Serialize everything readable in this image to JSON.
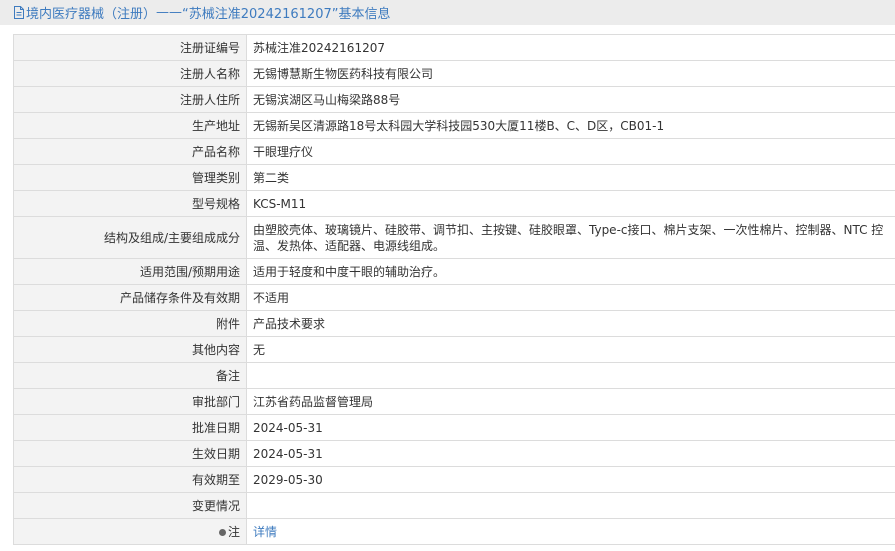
{
  "header": {
    "prefix": "境内医疗器械（注册）",
    "separator": " —— ",
    "title": "“苏械注准20242161207”基本信息"
  },
  "rows": [
    {
      "label": "注册证编号",
      "value": "苏械注准20242161207"
    },
    {
      "label": "注册人名称",
      "value": "无锡博慧斯生物医药科技有限公司"
    },
    {
      "label": "注册人住所",
      "value": "无锡滨湖区马山梅梁路88号"
    },
    {
      "label": "生产地址",
      "value": "无锡新吴区清源路18号太科园大学科技园530大厦11楼B、C、D区，CB01-1"
    },
    {
      "label": "产品名称",
      "value": "干眼理疗仪"
    },
    {
      "label": "管理类别",
      "value": "第二类"
    },
    {
      "label": "型号规格",
      "value": "KCS-M11"
    },
    {
      "label": "结构及组成/主要组成成分",
      "value": "由塑胶壳体、玻璃镜片、硅胶带、调节扣、主按键、硅胶眼罩、Type-c接口、棉片支架、一次性棉片、控制器、NTC 控温、发热体、适配器、电源线组成。"
    },
    {
      "label": "适用范围/预期用途",
      "value": "适用于轻度和中度干眼的辅助治疗。"
    },
    {
      "label": "产品储存条件及有效期",
      "value": "不适用"
    },
    {
      "label": "附件",
      "value": "产品技术要求"
    },
    {
      "label": "其他内容",
      "value": "无"
    },
    {
      "label": "备注",
      "value": ""
    },
    {
      "label": "审批部门",
      "value": "江苏省药品监督管理局"
    },
    {
      "label": "批准日期",
      "value": "2024-05-31"
    },
    {
      "label": "生效日期",
      "value": "2024-05-31"
    },
    {
      "label": "有效期至",
      "value": "2029-05-30"
    },
    {
      "label": "变更情况",
      "value": ""
    }
  ],
  "note_row": {
    "label": "注",
    "link": "详情"
  },
  "icons": {
    "header_icon": "document-icon",
    "note_icon": "bullet-icon"
  },
  "colors": {
    "link": "#3e7bbf",
    "header_bg": "#ececec",
    "label_bg": "#f3f3f3",
    "border": "#dcdcdc"
  }
}
